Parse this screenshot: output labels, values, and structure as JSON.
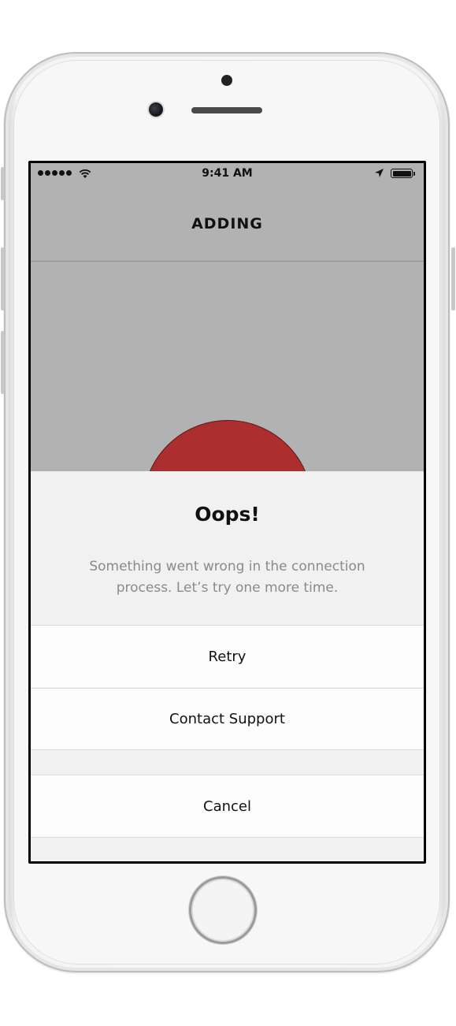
{
  "status_bar": {
    "time": "9:41 AM",
    "signal_icon": "signal-dots-icon",
    "wifi_icon": "wifi-icon",
    "location_icon": "location-arrow-icon",
    "battery_icon": "battery-icon"
  },
  "nav": {
    "title": "ADDING"
  },
  "colors": {
    "indicator_circle": "#ad2e2e",
    "background": "#b2b2b2",
    "sheet": "#f1f1f1"
  },
  "sheet": {
    "title": "Oops!",
    "message": "Something went wrong in the connection process. Let’s try one more time.",
    "actions": {
      "retry": "Retry",
      "contact_support": "Contact Support",
      "cancel": "Cancel"
    }
  }
}
